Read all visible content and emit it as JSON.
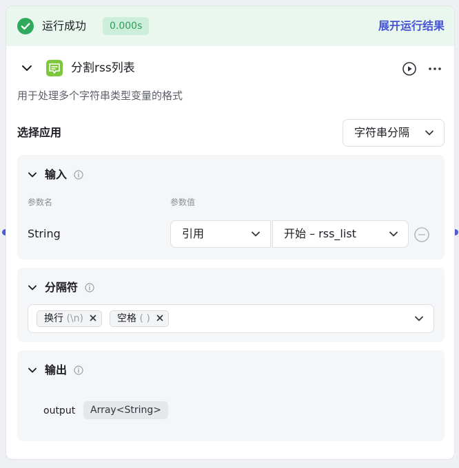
{
  "status": {
    "text": "运行成功",
    "time": "0.000s",
    "expand_label": "展开运行结果",
    "color": "#2faa5c"
  },
  "node": {
    "logo_icon": "str-split-logo",
    "title": "分割rss列表",
    "description": "用于处理多个字符串类型变量的格式"
  },
  "app": {
    "label": "选择应用",
    "selected": "字符串分隔"
  },
  "input": {
    "title": "输入",
    "col_name": "参数名",
    "col_value": "参数值",
    "param_name": "String",
    "ref_type": "引用",
    "ref_value": "开始 – rss_list"
  },
  "separator": {
    "title": "分隔符",
    "tags": [
      {
        "label": "换行",
        "hint": "(\\n)"
      },
      {
        "label": "空格",
        "hint": "( )"
      }
    ]
  },
  "output": {
    "title": "输出",
    "name": "output",
    "type": "Array<String>"
  },
  "colors": {
    "accent": "#4653d6",
    "success": "#2faa5c",
    "logo": "#7ec63b"
  }
}
